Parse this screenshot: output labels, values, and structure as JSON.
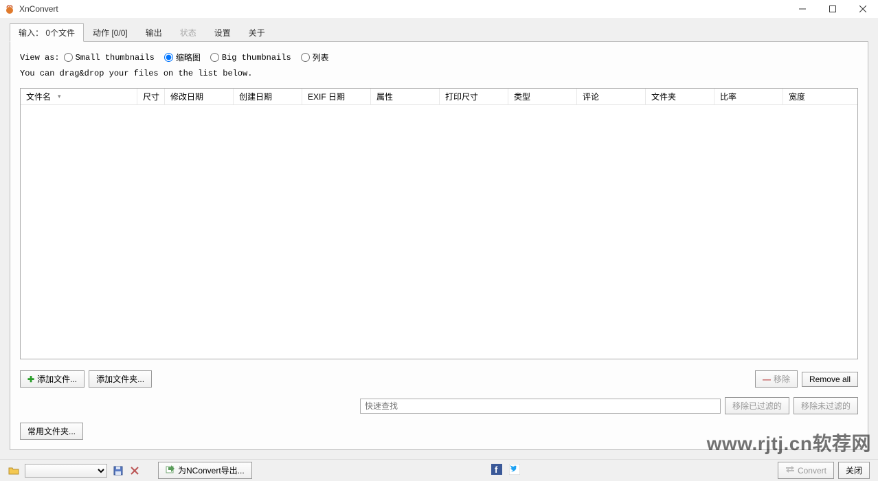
{
  "window": {
    "title": "XnConvert"
  },
  "tabs": {
    "input": "输入： 0个文件",
    "actions": "动作 [0/0]",
    "output": "输出",
    "status": "状态",
    "settings": "设置",
    "about": "关于"
  },
  "viewas": {
    "label": "View as:",
    "small": "Small thumbnails",
    "thumb": "缩略图",
    "big": "Big thumbnails",
    "list": "列表"
  },
  "hint": "You can drag&drop your files on the list below.",
  "columns": {
    "filename": "文件名",
    "size": "尺寸",
    "modified": "修改日期",
    "created": "创建日期",
    "exif": "EXIF 日期",
    "props": "属性",
    "printsize": "打印尺寸",
    "type": "类型",
    "comment": "评论",
    "folder": "文件夹",
    "ratio": "比率",
    "width": "宽度"
  },
  "buttons": {
    "addFiles": "添加文件...",
    "addFolder": "添加文件夹...",
    "remove": "移除",
    "removeAll": "Remove all",
    "removeFiltered": "移除已过滤的",
    "removeUnfiltered": "移除未过滤的",
    "commonFolders": "常用文件夹...",
    "exportNConvert": "为NConvert导出...",
    "convert": "Convert",
    "close": "关闭"
  },
  "filter": {
    "placeholder": "快速查找"
  },
  "watermark": "www.rjtj.cn软荐网"
}
